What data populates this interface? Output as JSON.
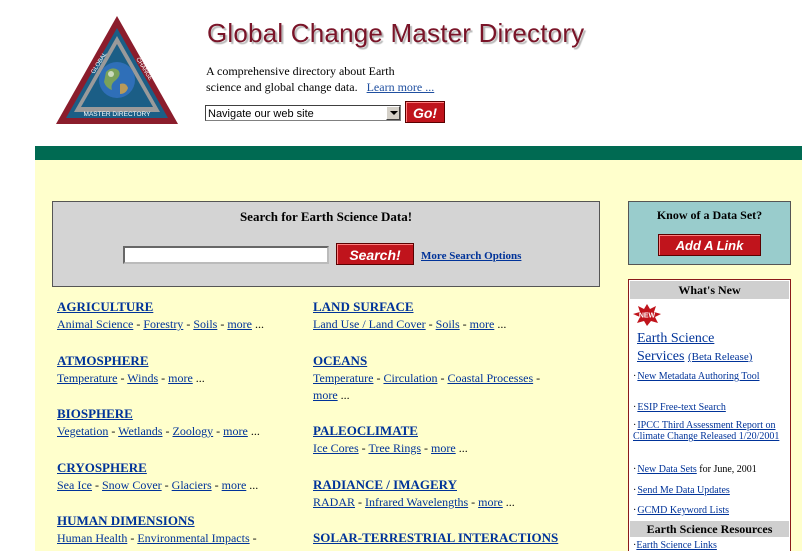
{
  "header": {
    "title": "Global Change Master Directory",
    "tagline_line1": "A comprehensive directory about Earth",
    "tagline_line2": "science and global change data.",
    "learn_more": "Learn more ...",
    "nav_select_value": "Navigate our web site",
    "go_label": "Go!"
  },
  "colors": {
    "title": "#7a1428",
    "band": "#006a52",
    "content_bg": "#ffffcc",
    "button_red": "#c0141c",
    "link_blue": "#003399"
  },
  "search": {
    "title": "Search for Earth Science Data!",
    "input_value": "",
    "button_label": "Search!",
    "more_options": "More Search Options"
  },
  "categories_left": [
    {
      "heading": "AGRICULTURE",
      "links": [
        "Animal Science",
        "Forestry",
        "Soils",
        "more"
      ],
      "trail": "..."
    },
    {
      "heading": "ATMOSPHERE",
      "links": [
        "Temperature",
        "Winds",
        "more"
      ],
      "trail": "..."
    },
    {
      "heading": "BIOSPHERE",
      "links": [
        "Vegetation",
        "Wetlands",
        "Zoology",
        "more"
      ],
      "trail": "..."
    },
    {
      "heading": "CRYOSPHERE",
      "links": [
        "Sea Ice",
        "Snow Cover",
        "Glaciers",
        "more"
      ],
      "trail": "..."
    },
    {
      "heading": "HUMAN DIMENSIONS",
      "links": [
        "Human Health",
        "Environmental Impacts"
      ],
      "trail": "-"
    }
  ],
  "categories_right": [
    {
      "heading": "LAND SURFACE",
      "links": [
        "Land Use / Land Cover",
        "Soils",
        "more"
      ],
      "trail": "..."
    },
    {
      "heading": "OCEANS",
      "links": [
        "Temperature",
        "Circulation",
        "Coastal Processes"
      ],
      "trail": "-",
      "line2": "more",
      "line2_trail": "..."
    },
    {
      "heading": "PALEOCLIMATE",
      "links": [
        "Ice Cores",
        "Tree Rings",
        "more"
      ],
      "trail": "..."
    },
    {
      "heading": "RADIANCE / IMAGERY",
      "links": [
        "RADAR",
        "Infrared Wavelengths",
        "more"
      ],
      "trail": "..."
    },
    {
      "heading": "SOLAR-TERRESTRIAL INTERACTIONS",
      "links": [],
      "trail": ""
    }
  ],
  "sidebar": {
    "know_title": "Know of a Data Set?",
    "add_link_label": "Add A Link",
    "whats_new_title": "What's New",
    "new_badge": "NEW",
    "featured_line1": "Earth Science",
    "featured_line2": "Services",
    "featured_beta": "(Beta Release)",
    "news": [
      {
        "text": "New Metadata Authoring Tool",
        "suffix": ""
      },
      {
        "text": "ESIP Free-text Search",
        "suffix": ""
      },
      {
        "text": "IPCC Third Assessment Report on Climate Change Released 1/20/2001",
        "suffix": ""
      },
      {
        "text": "New Data Sets",
        "suffix": " for June, 2001"
      },
      {
        "text": "Send Me Data Updates",
        "suffix": ""
      },
      {
        "text": "GCMD Keyword Lists",
        "suffix": ""
      }
    ],
    "resources_title": "Earth Science Resources",
    "resources_first": "Earth Science Links"
  },
  "logo": {
    "top_text": "GLOBAL",
    "right_text": "CHANGE",
    "bottom_text": "MASTER DIRECTORY"
  }
}
